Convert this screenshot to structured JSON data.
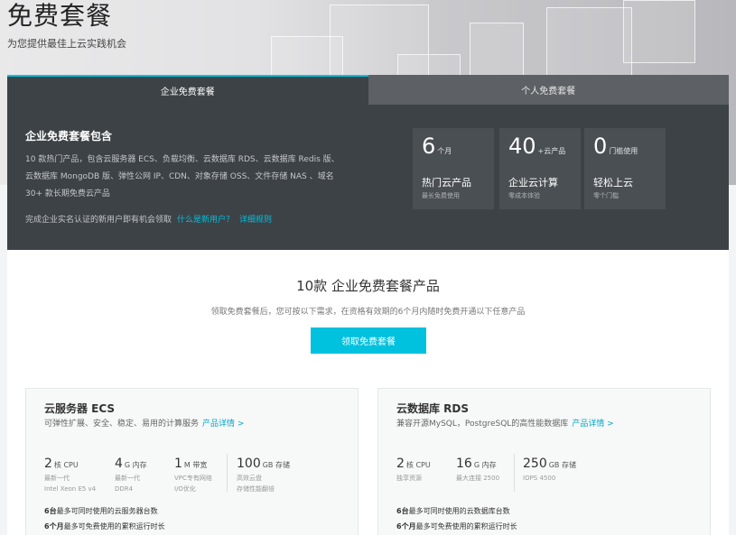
{
  "hero": {
    "title": "免费套餐",
    "subtitle": "为您提供最佳上云实践机会"
  },
  "tabs": [
    {
      "label": "企业免费套餐",
      "active": true
    },
    {
      "label": "个人免费套餐",
      "active": false
    }
  ],
  "panel": {
    "title": "企业免费套餐包含",
    "description": "10 款热门产品，包含云服务器 ECS、负载均衡、云数据库 RDS、云数据库 Redis 版、云数据库 MongoDB 版、弹性公网 IP、CDN、对象存储 OSS、文件存储 NAS 、域名 30+ 款长期免费云产品",
    "note": "完成企业实名认证的新用户即有机会领取",
    "link_new_user": "什么是新用户？",
    "link_rules": "详细规则",
    "stats": [
      {
        "number": "6",
        "unit": "个月",
        "label": "热门云产品",
        "sub": "最长免费使用"
      },
      {
        "number": "40",
        "unit": "+云产品",
        "label": "企业云计算",
        "sub": "零成本体验"
      },
      {
        "number": "0",
        "unit": "门槛使用",
        "label": "轻松上云",
        "sub": "零个门槛"
      }
    ]
  },
  "section": {
    "title": "10款 企业免费套餐产品",
    "subtitle": "领取免费套餐后，您可按以下需求，在资格有效期的6个月内随时免费开通以下任意产品",
    "cta_label": "领取免费套餐"
  },
  "cards": [
    {
      "title": "云服务器 ECS",
      "desc": "可弹性扩展、安全、稳定、易用的计算服务",
      "link": "产品详情 >",
      "specs": [
        {
          "value": "2",
          "unit": "核 CPU",
          "line1": "最新一代",
          "line2": "Intel Xeon E5 v4"
        },
        {
          "value": "4",
          "unit": "G 内存",
          "line1": "最新一代",
          "line2": "DDR4"
        },
        {
          "value": "1",
          "unit": "M 带宽",
          "line1": "VPC专有网络",
          "line2": "I/O优化"
        },
        {
          "value": "100",
          "unit": "GB 存储",
          "line1": "高效云盘",
          "line2": "存储性能翻倍"
        }
      ],
      "features": [
        {
          "bold": "6台",
          "text": "最多可同时使用的云服务器台数"
        },
        {
          "bold": "6个月",
          "text": "最多可免费使用的累积运行时长"
        }
      ]
    },
    {
      "title": "云数据库 RDS",
      "desc": "兼容开源MySQL，PostgreSQL的高性能数据库",
      "link": "产品详情 >",
      "specs": [
        {
          "value": "2",
          "unit": "核 CPU",
          "line1": "独享资源",
          "line2": ""
        },
        {
          "value": "16",
          "unit": "G 内存",
          "line1": "最大连接 2500",
          "line2": ""
        },
        {
          "value": "250",
          "unit": "GB 存储",
          "line1": "IOPS 4500",
          "line2": ""
        }
      ],
      "features": [
        {
          "bold": "6台",
          "text": "最多可同时使用的云数据库台数"
        },
        {
          "bold": "6个月",
          "text": "最多可免费使用的累积运行时长"
        }
      ]
    }
  ]
}
